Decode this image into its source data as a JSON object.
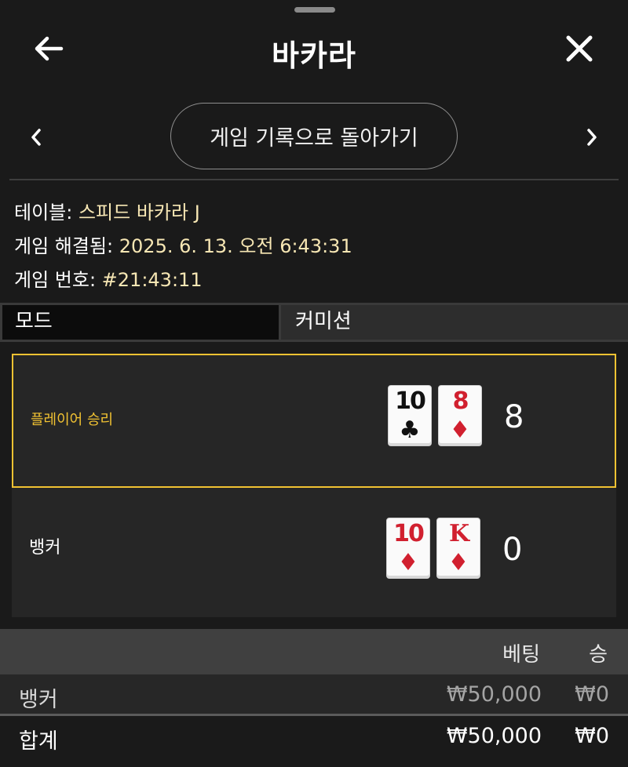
{
  "header": {
    "title": "바카라",
    "back_icon": "arrow-left-icon",
    "close_icon": "close-icon"
  },
  "nav": {
    "back_to_history_label": "게임 기록으로 돌아가기",
    "prev_icon": "chevron-left-icon",
    "next_icon": "chevron-right-icon"
  },
  "info": {
    "table_label": "테이블:",
    "table_value": " 스피드 바카라 J",
    "resolved_label": "게임 해결됨:",
    "resolved_value": " 2025. 6. 13. 오전 6:43:31",
    "number_label": "게임 번호:",
    "number_value": " #21:43:11"
  },
  "mode": {
    "label": "모드",
    "value": "커미션"
  },
  "results": {
    "player": {
      "label": "플레이어 승리",
      "cards": [
        {
          "rank": "10",
          "suit": "♣",
          "color": "black"
        },
        {
          "rank": "8",
          "suit": "♦",
          "color": "red"
        }
      ],
      "score": "8"
    },
    "banker": {
      "label": "뱅커",
      "cards": [
        {
          "rank": "10",
          "suit": "♦",
          "color": "red"
        },
        {
          "rank": "K",
          "suit": "♦",
          "color": "red"
        }
      ],
      "score": "0"
    }
  },
  "bets": {
    "col_bet": "베팅",
    "col_win": "승",
    "rows": [
      {
        "name": "뱅커",
        "amount": "₩50,000",
        "win": "₩0"
      }
    ],
    "total": {
      "name": "합계",
      "amount": "₩50,000",
      "win": "₩0"
    }
  },
  "colors": {
    "accent_gold": "#f1c232",
    "info_value": "#f7e7b4",
    "card_red": "#d1202f"
  }
}
